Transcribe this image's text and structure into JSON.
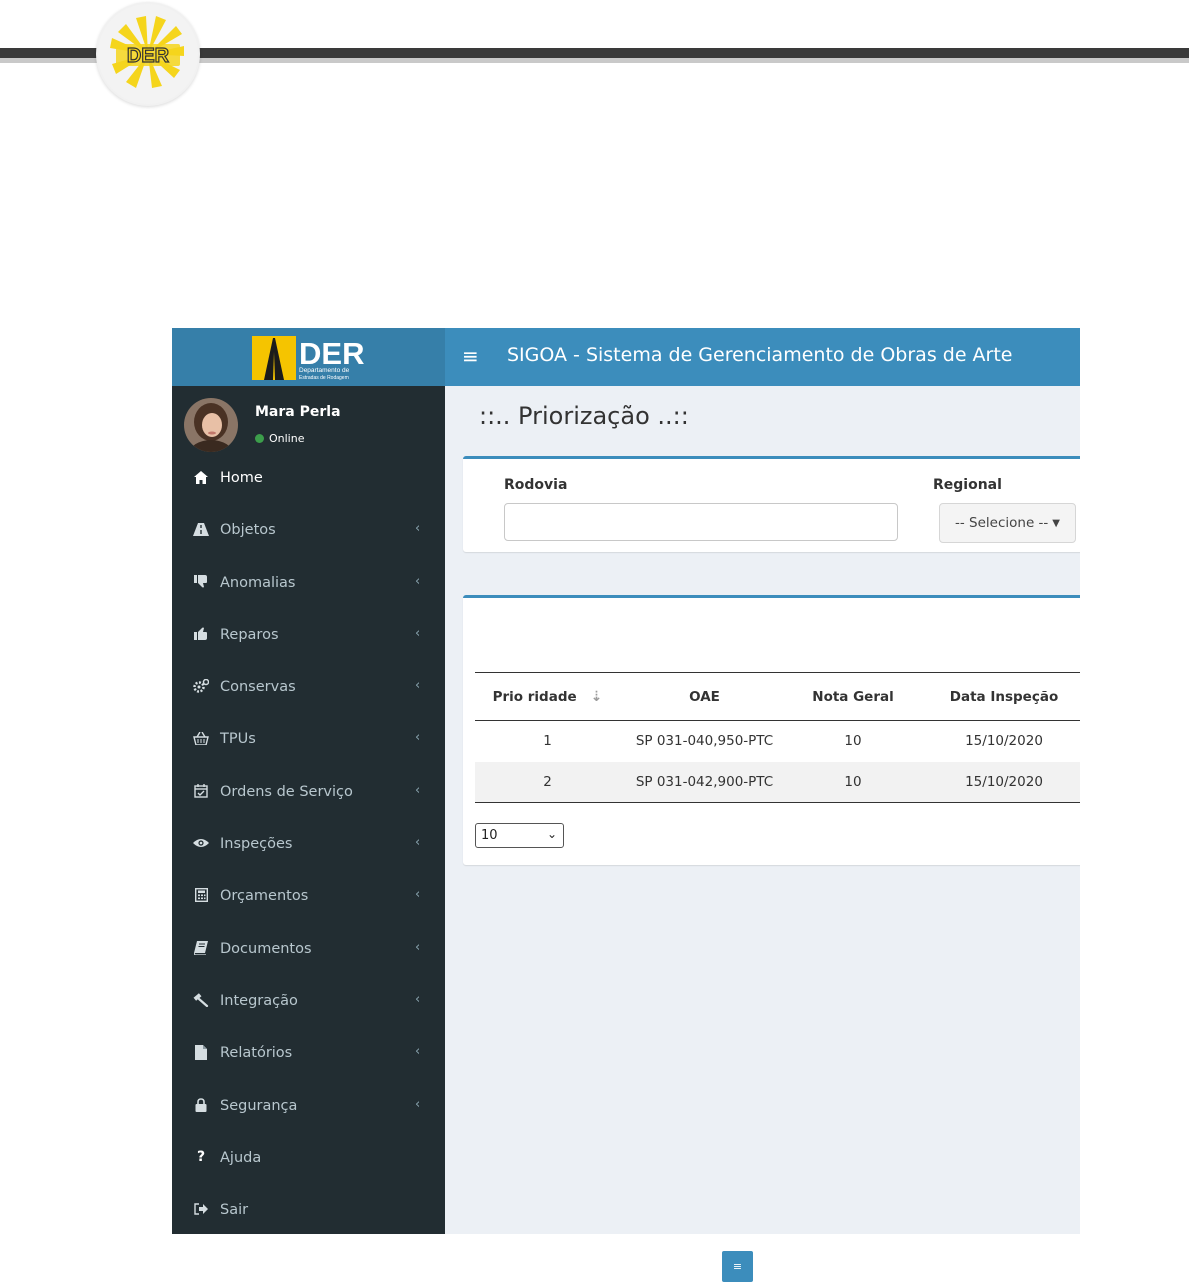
{
  "doc_header": {
    "seal_text": "DER"
  },
  "app": {
    "logo": {
      "acronym": "DER",
      "line1": "Departamento de",
      "line2": "Estradas de Rodagem"
    },
    "topbar": {
      "menu_icon": "hamburger-icon",
      "title": "SIGOA - Sistema de Gerenciamento de Obras de Arte"
    },
    "user": {
      "name": "Mara Perla",
      "status": "Online",
      "status_color": "#3c9e4b"
    },
    "menu": [
      {
        "label": "Home",
        "icon": "home-icon",
        "has_submenu": false
      },
      {
        "label": "Objetos",
        "icon": "road-icon",
        "has_submenu": true
      },
      {
        "label": "Anomalias",
        "icon": "thumbs-down-icon",
        "has_submenu": true
      },
      {
        "label": "Reparos",
        "icon": "thumbs-up-icon",
        "has_submenu": true
      },
      {
        "label": "Conservas",
        "icon": "gears-icon",
        "has_submenu": true
      },
      {
        "label": "TPUs",
        "icon": "basket-icon",
        "has_submenu": true
      },
      {
        "label": "Ordens de Serviço",
        "icon": "calendar-check-icon",
        "has_submenu": true
      },
      {
        "label": "Inspeções",
        "icon": "eye-icon",
        "has_submenu": true
      },
      {
        "label": "Orçamentos",
        "icon": "calculator-icon",
        "has_submenu": true
      },
      {
        "label": "Documentos",
        "icon": "book-icon",
        "has_submenu": true
      },
      {
        "label": "Integração",
        "icon": "gavel-icon",
        "has_submenu": true
      },
      {
        "label": "Relatórios",
        "icon": "file-icon",
        "has_submenu": true
      },
      {
        "label": "Segurança",
        "icon": "lock-icon",
        "has_submenu": true
      },
      {
        "label": "Ajuda",
        "icon": "question-icon",
        "has_submenu": false
      },
      {
        "label": "Sair",
        "icon": "sign-out-icon",
        "has_submenu": false
      }
    ],
    "page_title": "::.. Priorização ..::",
    "filters": {
      "rodovia_label": "Rodovia",
      "rodovia_value": "",
      "regional_label": "Regional",
      "regional_selected": "-- Selecione --"
    },
    "table": {
      "columns": [
        "Prio ridade",
        "OAE",
        "Nota Geral",
        "Data Inspeção"
      ],
      "rows": [
        [
          "1",
          "SP 031-040,950-PTC",
          "10",
          "15/10/2020"
        ],
        [
          "2",
          "SP 031-042,900-PTC",
          "10",
          "15/10/2020"
        ]
      ]
    },
    "page_size": "10"
  },
  "bottom_button_icon": "menu-lines-icon",
  "colors": {
    "sidebar": "#222d32",
    "topbar": "#3c8dbc",
    "logo_bg": "#367fa9",
    "content_bg": "#ecf0f5"
  }
}
